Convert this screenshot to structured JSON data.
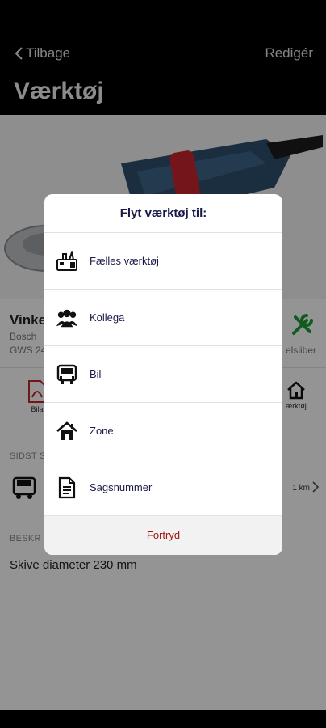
{
  "nav": {
    "back_label": "Tilbage",
    "edit_label": "Redigér",
    "title": "Værktøj"
  },
  "tool": {
    "name": "Vinke",
    "brand": "Bosch",
    "model": "GWS 24",
    "type": "elsliber"
  },
  "actions": {
    "pdf_label": "Bila",
    "zone_label": "ærktøj"
  },
  "last_seen": {
    "section_label": "SIDST S",
    "distance": "1 km"
  },
  "description": {
    "section_label": "BESKR",
    "text": "Skive diameter  230 mm"
  },
  "move_sheet": {
    "title": "Flyt værktøj til:",
    "options": [
      {
        "label": "Fælles værktøj",
        "icon": "toolbox-icon"
      },
      {
        "label": "Kollega",
        "icon": "colleagues-icon"
      },
      {
        "label": "Bil",
        "icon": "van-icon"
      },
      {
        "label": "Zone",
        "icon": "house-icon"
      },
      {
        "label": "Sagsnummer",
        "icon": "document-icon"
      }
    ],
    "cancel_label": "Fortryd"
  },
  "colors": {
    "accent_green": "#1e9e3a",
    "cancel_red": "#a01515",
    "sheet_text": "#1a1a4a"
  }
}
